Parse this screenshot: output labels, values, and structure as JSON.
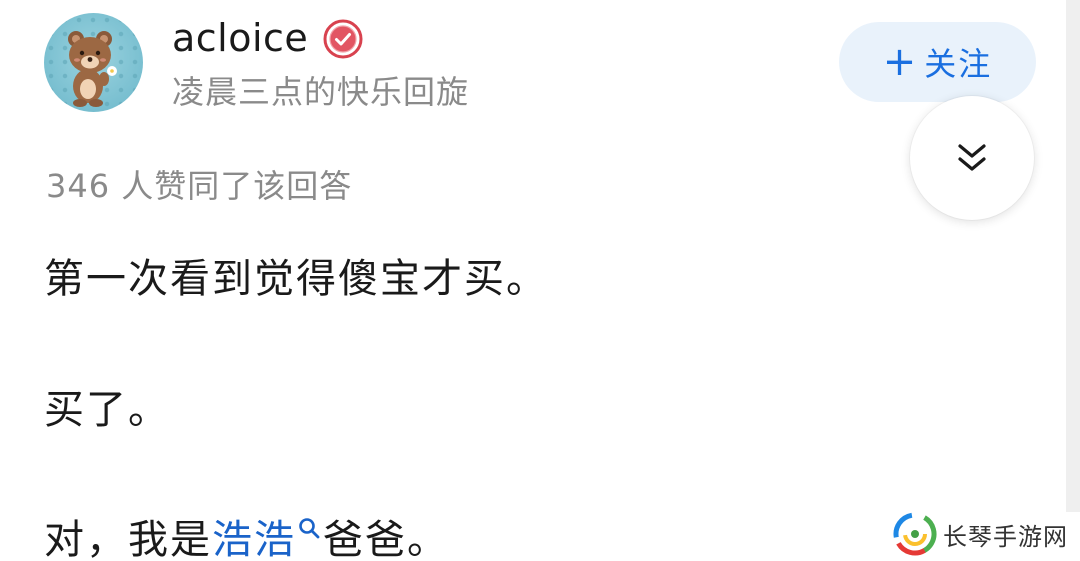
{
  "author": {
    "name": "acloice",
    "bio": "凌晨三点的快乐回旋",
    "avatar_icon": "bear-avatar-icon",
    "badge_icon": "verified-badge-icon"
  },
  "actions": {
    "follow_plus": "+",
    "follow_label": "关注",
    "collapse_icon": "chevron-double-down-icon"
  },
  "answer": {
    "vote_count_text": "346 人赞同了该回答",
    "line1": "第一次看到觉得傻宝才买。",
    "line2": "买了。",
    "line3_prefix": "对，我是",
    "line3_link": "浩浩",
    "line3_suffix": "爸爸。"
  },
  "watermark": {
    "text": "长琴手游网"
  },
  "colors": {
    "link": "#1a63c9",
    "follow_text": "#1a6fe0",
    "follow_bg": "#e9f2fb",
    "muted_text": "#8a8a8a"
  }
}
